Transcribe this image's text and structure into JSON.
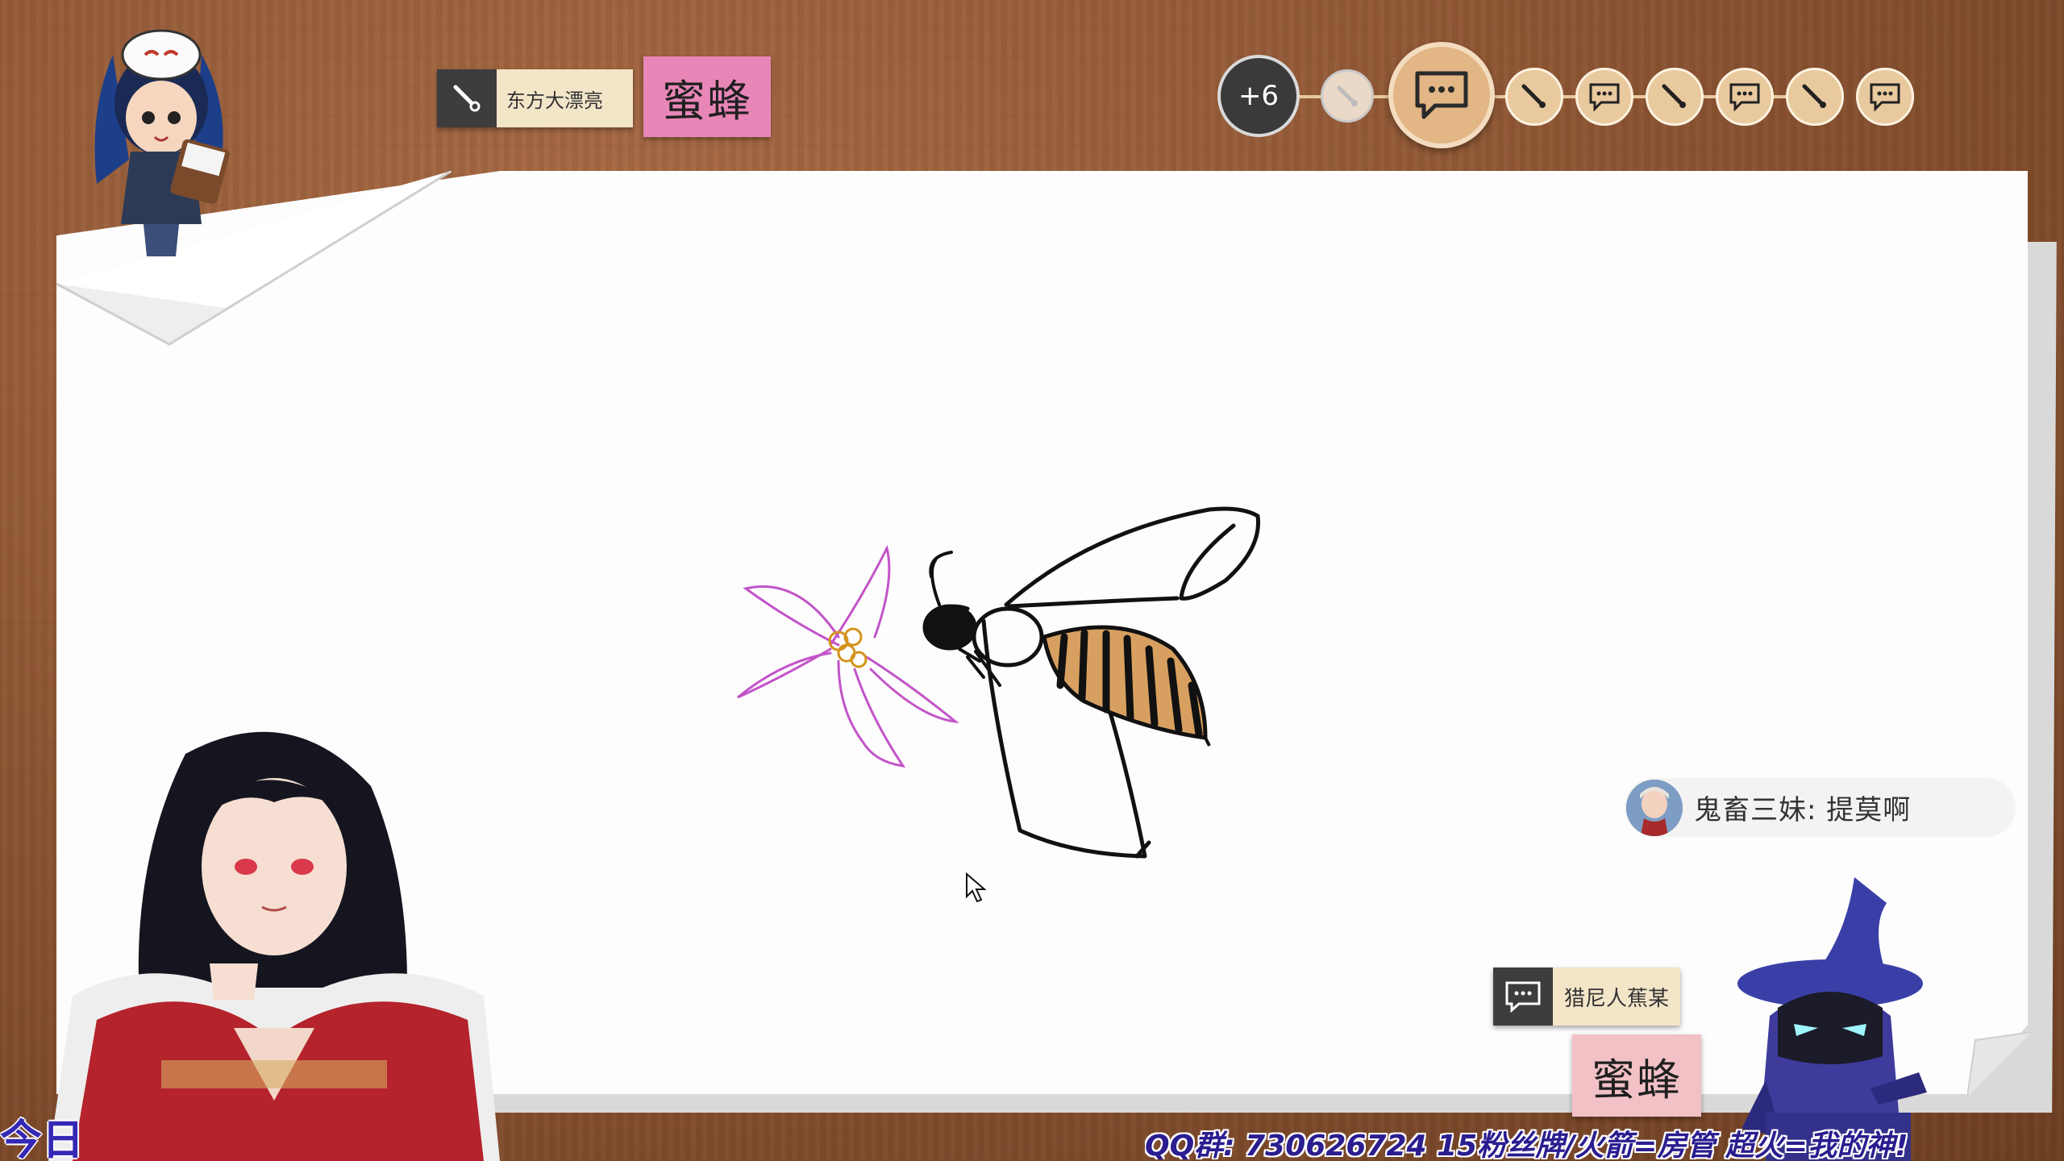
{
  "header": {
    "drawer_name": "东方大漂亮",
    "word": "蜜蜂"
  },
  "timeline": {
    "remaining_count": "+6",
    "icons": [
      "brush-icon",
      "chat-icon",
      "brush-icon",
      "chat-icon",
      "brush-icon",
      "chat-icon",
      "brush-icon",
      "chat-icon"
    ]
  },
  "chat": {
    "message": "鬼畜三妹: 提莫啊"
  },
  "guess_card": {
    "player_name": "猎尼人蕉某",
    "word": "蜜蜂"
  },
  "ticker": {
    "text": "QQ群: 730626724 15粉丝牌/火箭=房管 超火=我的神!",
    "left_text": "今日"
  },
  "colors": {
    "wood": "#8f5735",
    "tag_dark": "#3d3d3d",
    "name_bg": "#f3e5c8",
    "word_pink": "#e986b8",
    "word_light_pink": "#f2c1c6",
    "node_tan": "#e9c99e",
    "ticker_blue": "#2b1d8f"
  }
}
